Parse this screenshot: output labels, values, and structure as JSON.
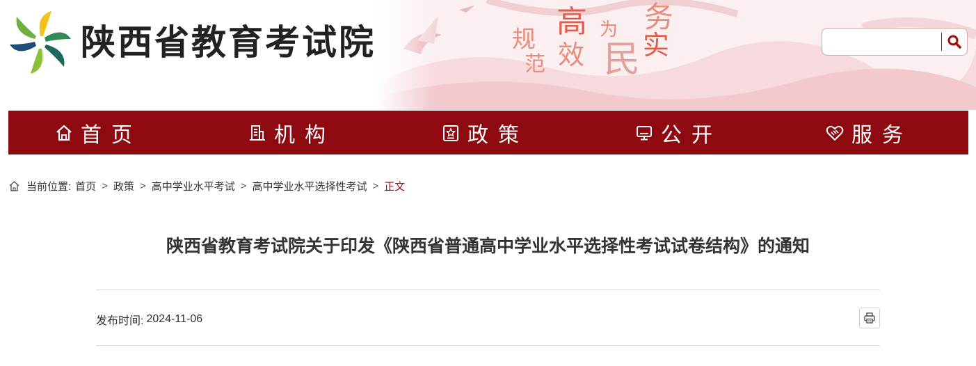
{
  "header": {
    "site_name": "陕西省教育考试院",
    "logo_icon": "pinwheel-logo-icon",
    "slogan_chars": [
      "规",
      "范",
      "高",
      "效",
      "为",
      "民",
      "务",
      "实"
    ],
    "search": {
      "value": "",
      "placeholder": "",
      "button_icon": "search-icon"
    }
  },
  "nav": {
    "items": [
      {
        "label": "首页",
        "icon": "home-icon"
      },
      {
        "label": "机构",
        "icon": "building-icon"
      },
      {
        "label": "政策",
        "icon": "document-star-icon"
      },
      {
        "label": "公开",
        "icon": "monitor-icon"
      },
      {
        "label": "服务",
        "icon": "handshake-heart-icon"
      }
    ]
  },
  "breadcrumb": {
    "icon": "home-outline-icon",
    "prefix": "当前位置:",
    "items": [
      "首页",
      "政策",
      "高中学业水平考试",
      "高中学业水平选择性考试"
    ],
    "current": "正文",
    "separator": ">"
  },
  "article": {
    "title": "陕西省教育考试院关于印发《陕西省普通高中学业水平选择性考试试卷结构》的通知",
    "publish_label": "发布时间:",
    "publish_date": "2024-11-06",
    "print_icon": "printer-icon"
  },
  "colors": {
    "nav_bg": "#8e0a10",
    "accent": "#9e0b0f",
    "text": "#333333",
    "rule": "#dedede"
  }
}
